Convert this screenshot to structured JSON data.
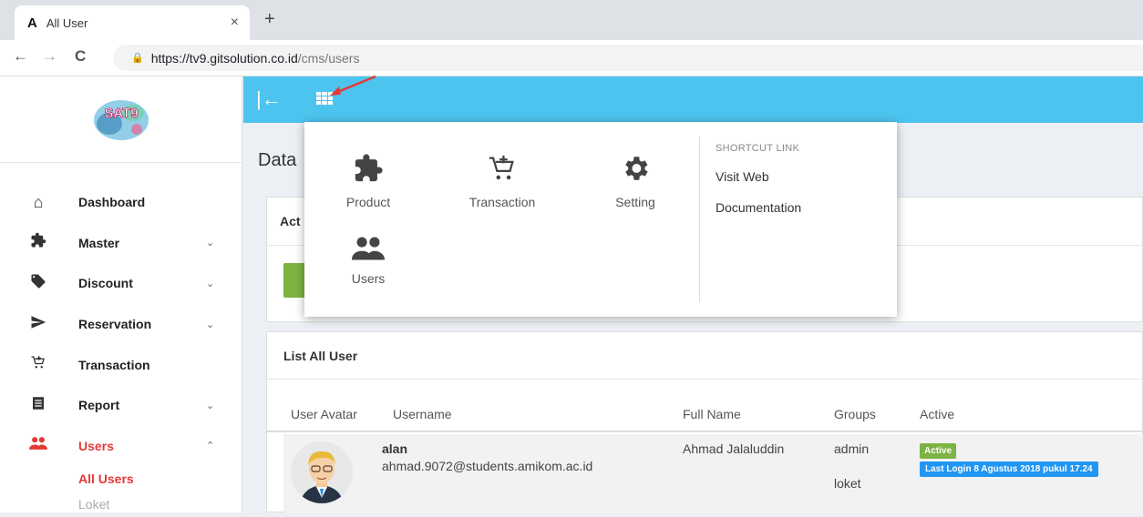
{
  "browser": {
    "tab_favicon": "A",
    "tab_title": "All User",
    "tab_close": "×",
    "new_tab": "+",
    "back": "←",
    "forward": "→",
    "reload": "C",
    "url_host": "https://tv9.gitsolution.co.id",
    "url_path": "/cms/users"
  },
  "sidebar": {
    "items": [
      {
        "label": "Dashboard",
        "icon": "home-icon",
        "chevron": ""
      },
      {
        "label": "Master",
        "icon": "puzzle-icon",
        "chevron": "⌄"
      },
      {
        "label": "Discount",
        "icon": "tag-icon",
        "chevron": "⌄"
      },
      {
        "label": "Reservation",
        "icon": "send-icon",
        "chevron": "⌄"
      },
      {
        "label": "Transaction",
        "icon": "cart-icon",
        "chevron": ""
      },
      {
        "label": "Report",
        "icon": "report-icon",
        "chevron": "⌄"
      },
      {
        "label": "Users",
        "icon": "users-icon",
        "chevron": "⌃"
      }
    ],
    "sub_items": [
      "All Users",
      "Loket"
    ]
  },
  "topbar": {
    "collapse_icon": "|←"
  },
  "page": {
    "title": "Data"
  },
  "action_box": {
    "title": "Act"
  },
  "list_box": {
    "title": "List All User",
    "columns": [
      "User Avatar",
      "Username",
      "Full Name",
      "Groups",
      "Active"
    ],
    "rows": [
      {
        "username": "alan",
        "email": "ahmad.9072@students.amikom.ac.id",
        "full_name": "Ahmad Jalaluddin",
        "groups": [
          "admin",
          "loket"
        ],
        "status": "Active",
        "last_login": "Last Login 8 Agustus 2018 pukul 17.24"
      }
    ]
  },
  "dropdown": {
    "apps": [
      {
        "label": "Product",
        "icon": "puzzle-icon"
      },
      {
        "label": "Transaction",
        "icon": "cart-icon"
      },
      {
        "label": "Setting",
        "icon": "gear-icon"
      },
      {
        "label": "Users",
        "icon": "users-icon"
      }
    ],
    "shortcut_title": "SHORTCUT LINK",
    "shortcut_links": [
      "Visit Web",
      "Documentation"
    ]
  },
  "colors": {
    "topbar": "#4dc4ef",
    "active_menu": "#e53935",
    "badge_active": "#7cb342",
    "badge_login": "#2196f3"
  }
}
